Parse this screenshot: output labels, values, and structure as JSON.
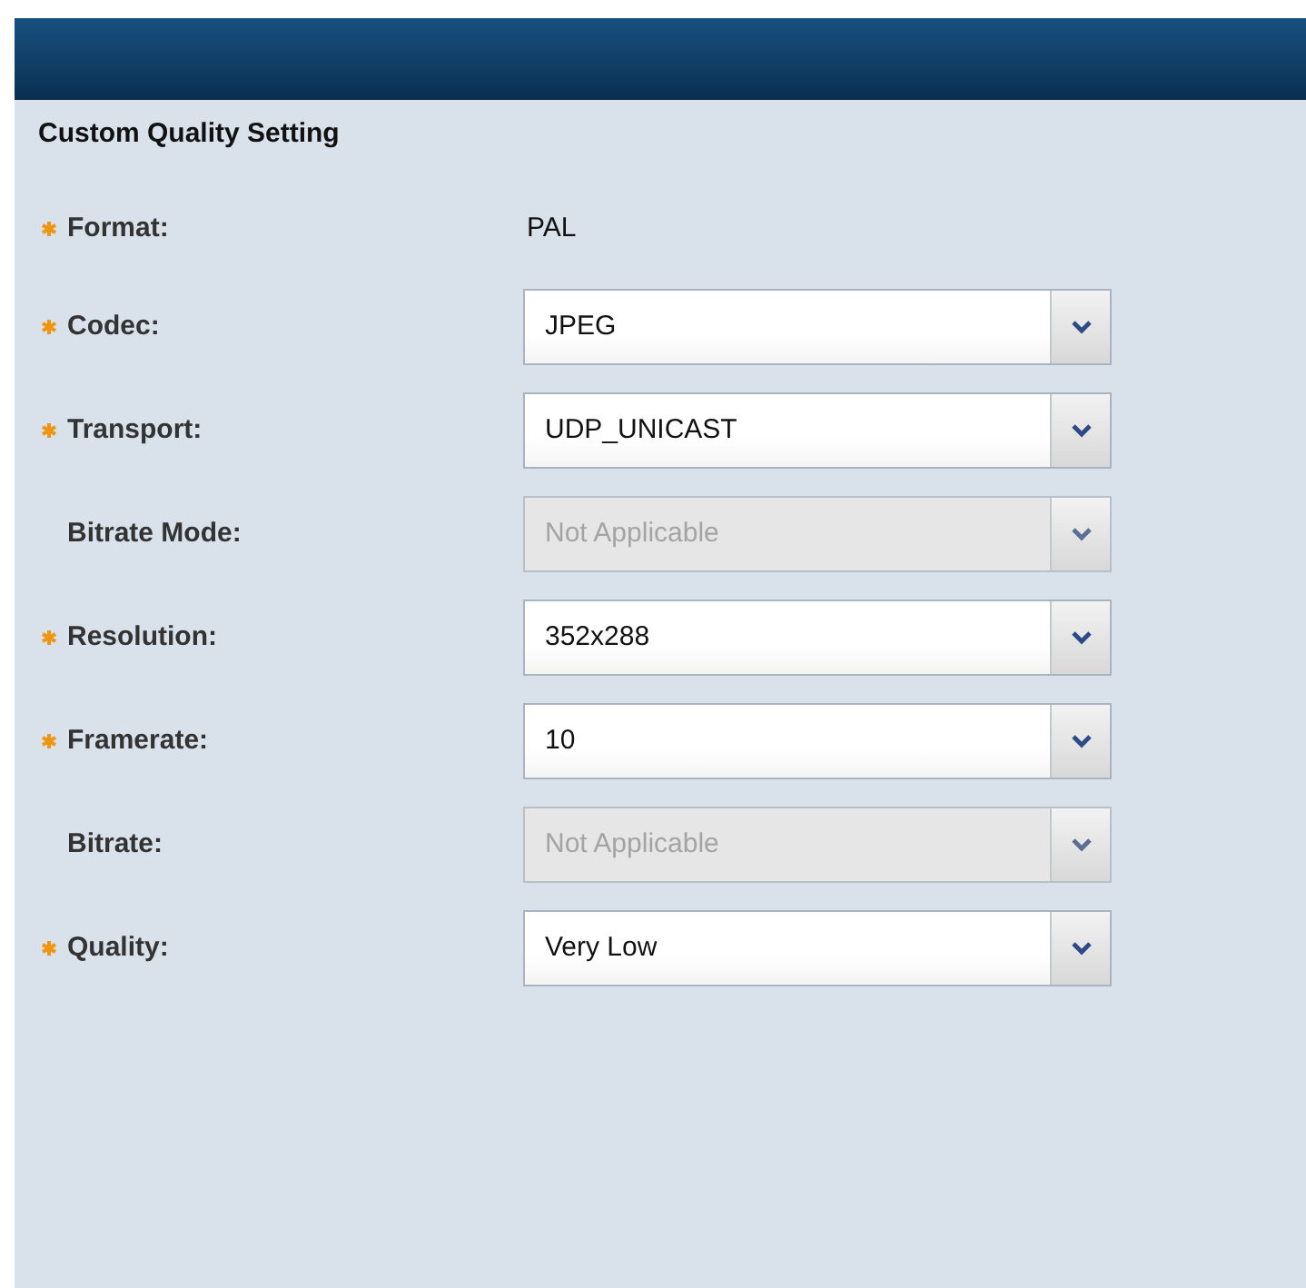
{
  "panel": {
    "title": "Custom Quality Setting"
  },
  "fields": [
    {
      "label": "Format:",
      "required": true,
      "kind": "text",
      "value": "PAL"
    },
    {
      "label": "Codec:",
      "required": true,
      "kind": "select",
      "value": "JPEG",
      "disabled": false
    },
    {
      "label": "Transport:",
      "required": true,
      "kind": "select",
      "value": "UDP_UNICAST",
      "disabled": false
    },
    {
      "label": "Bitrate Mode:",
      "required": false,
      "kind": "select",
      "value": "Not Applicable",
      "disabled": true
    },
    {
      "label": "Resolution:",
      "required": true,
      "kind": "select",
      "value": "352x288",
      "disabled": false
    },
    {
      "label": "Framerate:",
      "required": true,
      "kind": "select",
      "value": "10",
      "disabled": false
    },
    {
      "label": "Bitrate:",
      "required": false,
      "kind": "select",
      "value": "Not Applicable",
      "disabled": true
    },
    {
      "label": "Quality:",
      "required": true,
      "kind": "select",
      "value": "Very Low",
      "disabled": false
    }
  ]
}
